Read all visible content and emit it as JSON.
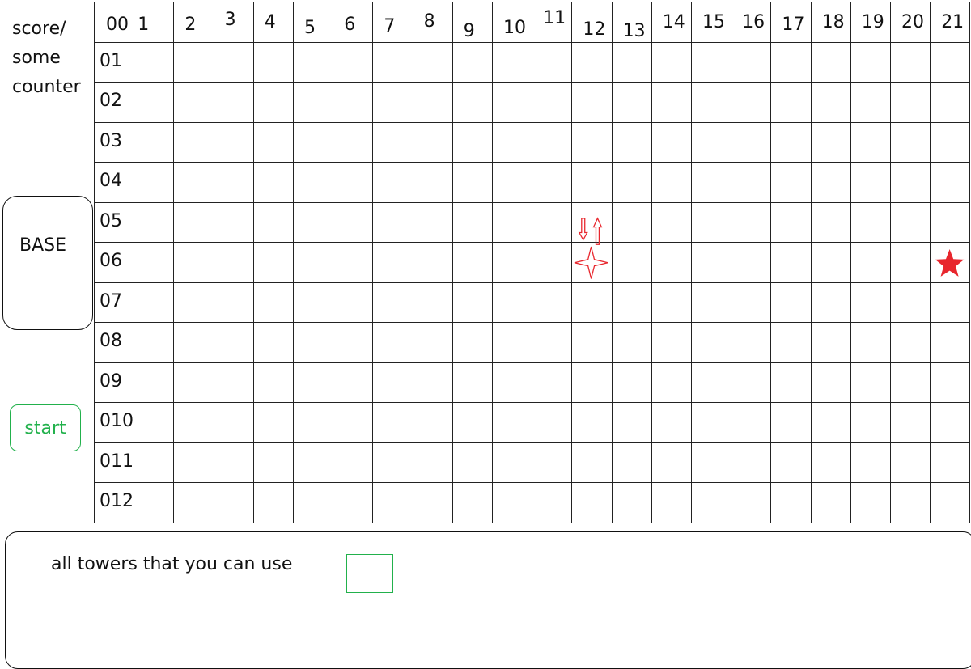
{
  "score_label": "score/\nsome\ncounter",
  "base": {
    "label": "BASE"
  },
  "start_button": {
    "label": "start",
    "color": "#22b14c"
  },
  "grid": {
    "corner_label": "00",
    "col_labels": [
      "1",
      "2",
      "3",
      "4",
      "5",
      "6",
      "7",
      "8",
      "9",
      "10",
      "11",
      "12",
      "13",
      "14",
      "15",
      "16",
      "17",
      "18",
      "19",
      "20",
      "21"
    ],
    "row_labels": [
      "01",
      "02",
      "03",
      "04",
      "05",
      "06",
      "07",
      "08",
      "09",
      "010",
      "011",
      "012"
    ]
  },
  "markers": [
    {
      "type": "arrows-up-down-icon",
      "row": 5,
      "col": 12,
      "color": "#e8262d"
    },
    {
      "type": "four-point-star-icon",
      "row": 6,
      "col": 12,
      "color": "#e8262d"
    },
    {
      "type": "star-icon",
      "row": 6,
      "col": 21,
      "color": "#e8262d"
    }
  ],
  "towers_panel": {
    "label": "all towers that you can use",
    "slot_color": "#22b14c"
  }
}
